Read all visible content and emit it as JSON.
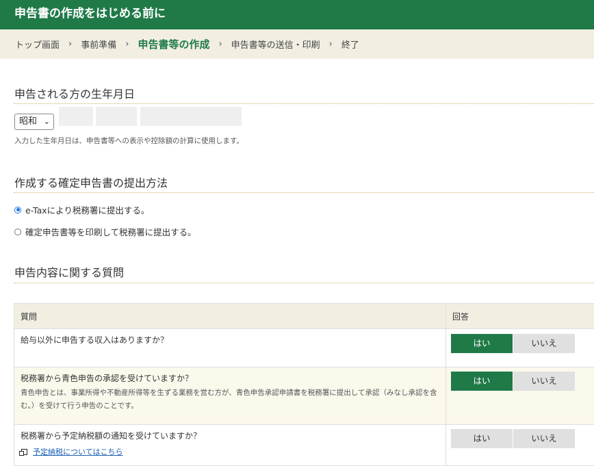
{
  "header": {
    "title": "申告書の作成をはじめる前に"
  },
  "breadcrumb": {
    "items": [
      "トップ画面",
      "事前準備",
      "申告書等の作成",
      "申告書等の送信・印刷",
      "終了"
    ],
    "separator": "›",
    "current_index": 2
  },
  "birth": {
    "title": "申告される方の生年月日",
    "era_value": "昭和",
    "note": "入力した生年月日は、申告書等への表示や控除額の計算に使用します。"
  },
  "submit": {
    "title": "作成する確定申告書の提出方法",
    "options": [
      {
        "label": "e-Taxにより税務署に提出する。",
        "selected": true
      },
      {
        "label": "確定申告書等を印刷して税務署に提出する。",
        "selected": false
      }
    ]
  },
  "questions": {
    "title": "申告内容に関する質問",
    "col_question": "質問",
    "col_answer": "回答",
    "yes_label": "はい",
    "no_label": "いいえ",
    "rows": [
      {
        "text": "給与以外に申告する収入はありますか？",
        "answer": "yes"
      },
      {
        "text": "税務署から青色申告の承認を受けていますか？",
        "note": "青色申告とは、事業所得や不動産所得等を生ずる業務を営む方が、青色申告承認申請書を税務署に提出して承認（みなし承認を含む。）を受けて行う申告のことです。",
        "answer": "yes"
      },
      {
        "text": "税務署から予定納税額の通知を受けていますか？",
        "link": "予定納税についてはこちら",
        "answer": "none"
      }
    ]
  },
  "colors": {
    "brand": "#1f7a48",
    "crumb_bg": "#f2efe2",
    "rule": "#c9b56a",
    "link": "#1a5fb4"
  }
}
